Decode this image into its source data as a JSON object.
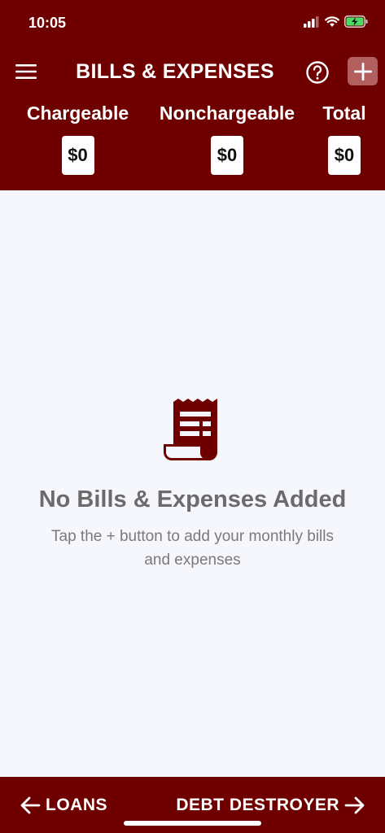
{
  "status_bar": {
    "time": "10:05",
    "icons": [
      "signal-icon",
      "wifi-icon",
      "battery-charging-icon"
    ]
  },
  "header": {
    "title": "BILLS & EXPENSES",
    "menu_icon": "menu-icon",
    "help_icon": "help-circle-icon",
    "add_icon": "plus-icon",
    "background_color": "#6f0000",
    "add_button_color": "#b25f5f"
  },
  "totals": [
    {
      "label": "Chargeable",
      "value": "$0"
    },
    {
      "label": "Nonchargeable",
      "value": "$0"
    },
    {
      "label": "Total",
      "value": "$0"
    }
  ],
  "empty_state": {
    "icon": "receipt-icon",
    "title": "No Bills & Expenses Added",
    "subtitle": "Tap the + button to add your monthly bills and expenses"
  },
  "bottom_nav": {
    "back_label": "LOANS",
    "next_label": "DEBT DESTROYER"
  }
}
